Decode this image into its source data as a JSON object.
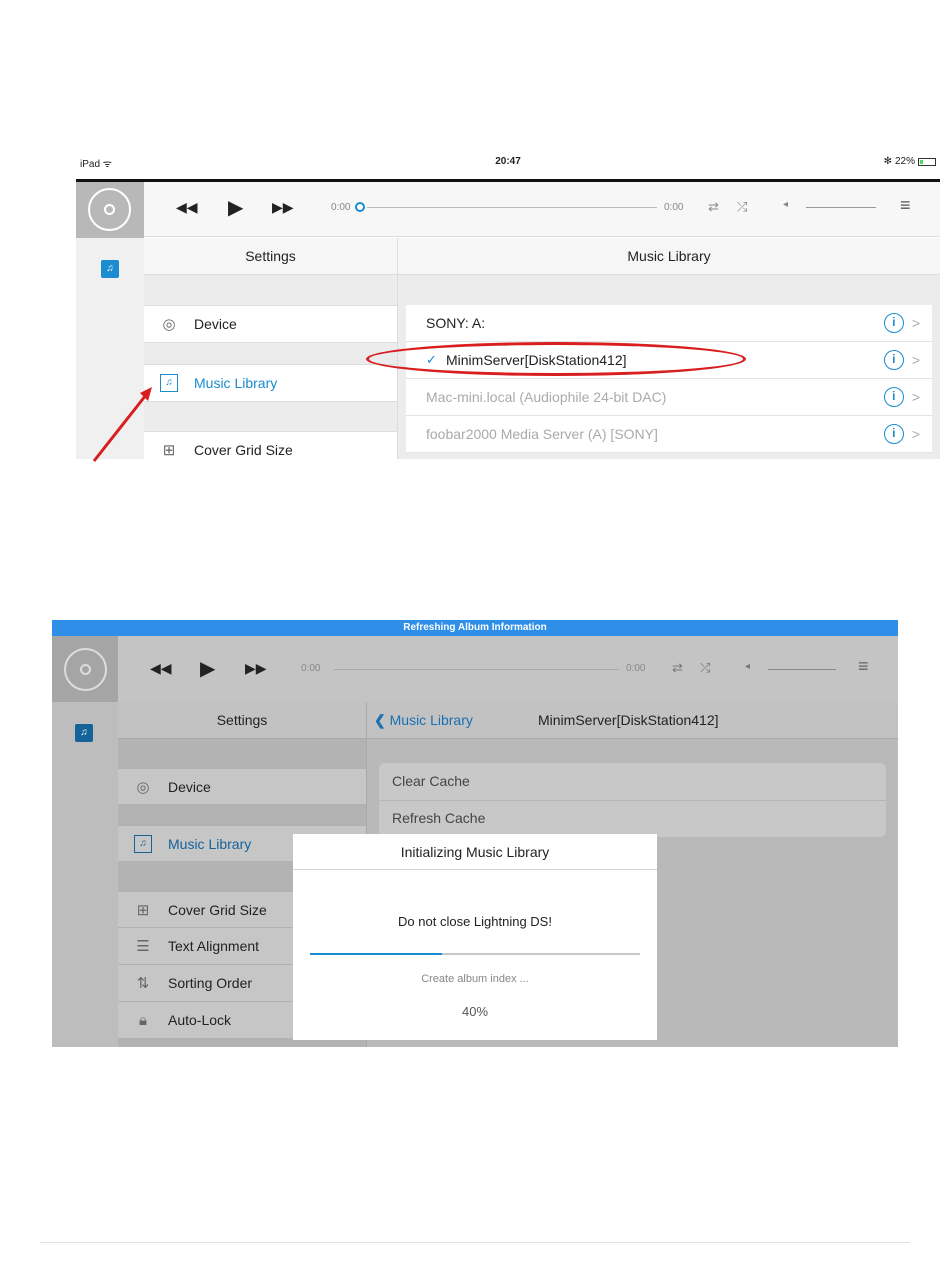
{
  "shot1": {
    "status_bar": {
      "device": "iPad",
      "time": "20:47",
      "battery": "22%"
    },
    "player": {
      "elapsed": "0:00",
      "remaining": "0:00"
    },
    "settings_panel": {
      "title": "Settings",
      "items": [
        {
          "label": "Device"
        },
        {
          "label": "Music Library"
        },
        {
          "label": "Cover Grid Size"
        }
      ]
    },
    "library_panel": {
      "title": "Music Library",
      "servers": [
        {
          "label": "SONY: A:",
          "selected": false,
          "dimmed": false
        },
        {
          "label": "MinimServer[DiskStation412]",
          "selected": true,
          "dimmed": false
        },
        {
          "label": "Mac-mini.local (Audiophile 24-bit DAC)",
          "selected": false,
          "dimmed": true
        },
        {
          "label": "foobar2000 Media Server (A) [SONY]",
          "selected": false,
          "dimmed": true
        }
      ],
      "check_glyph": "✓",
      "info_glyph": "i",
      "chevron_glyph": ">"
    },
    "annotation_color": "#d81e1e"
  },
  "shot2": {
    "banner": "Refreshing Album Information",
    "player": {
      "elapsed": "0:00",
      "remaining": "0:00"
    },
    "settings_panel": {
      "title": "Settings",
      "items": [
        {
          "label": "Device"
        },
        {
          "label": "Music Library"
        },
        {
          "label": "Cover Grid Size"
        },
        {
          "label": "Text Alignment"
        },
        {
          "label": "Sorting Order"
        },
        {
          "label": "Auto-Lock"
        }
      ]
    },
    "detail": {
      "back_label": "Music Library",
      "title": "MinimServer[DiskStation412]",
      "actions": [
        "Clear Cache",
        "Refresh Cache"
      ]
    },
    "dialog": {
      "title": "Initializing Music Library",
      "message": "Do not close Lightning DS!",
      "progress": 0.4,
      "status": "Create album index ...",
      "percent": "40%"
    }
  },
  "accent_color": "#1a8ccf"
}
